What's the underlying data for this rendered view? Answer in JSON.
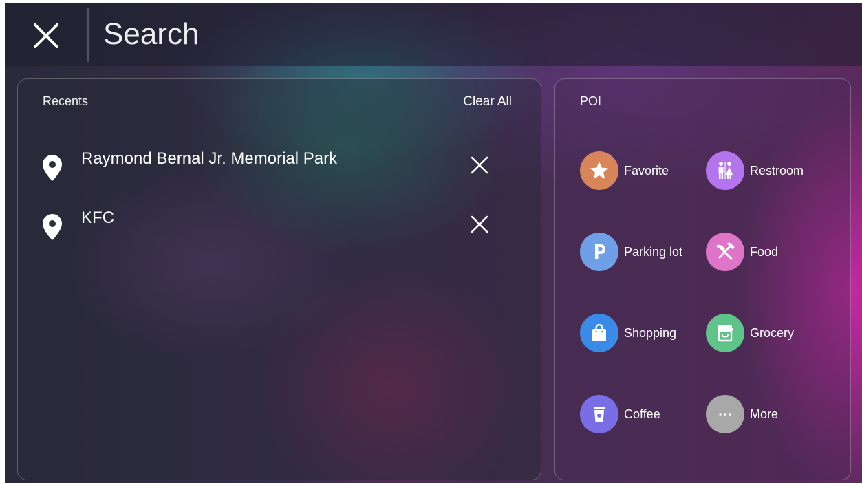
{
  "header": {
    "search_placeholder": "Search"
  },
  "recents": {
    "title": "Recents",
    "clear_all": "Clear All",
    "items": [
      {
        "label": "Raymond Bernal Jr. Memorial Park",
        "icon": "location-pin-icon"
      },
      {
        "label": "KFC",
        "icon": "location-pin-icon"
      }
    ]
  },
  "poi": {
    "title": "POI",
    "items": [
      {
        "label": "Favorite",
        "icon": "star-icon",
        "color": "#d9855a"
      },
      {
        "label": "Restroom",
        "icon": "restroom-icon",
        "color": "#b374ee"
      },
      {
        "label": "Parking lot",
        "icon": "parking-icon",
        "color": "#6f9fe6"
      },
      {
        "label": "Food",
        "icon": "fork-knife-icon",
        "color": "#df75c8"
      },
      {
        "label": "Shopping",
        "icon": "shopping-bag-icon",
        "color": "#3a8ae8"
      },
      {
        "label": "Grocery",
        "icon": "store-icon",
        "color": "#5fc48a"
      },
      {
        "label": "Coffee",
        "icon": "coffee-cup-icon",
        "color": "#7a6ee6"
      },
      {
        "label": "More",
        "icon": "more-icon",
        "color": "#a8a8a8"
      }
    ]
  }
}
